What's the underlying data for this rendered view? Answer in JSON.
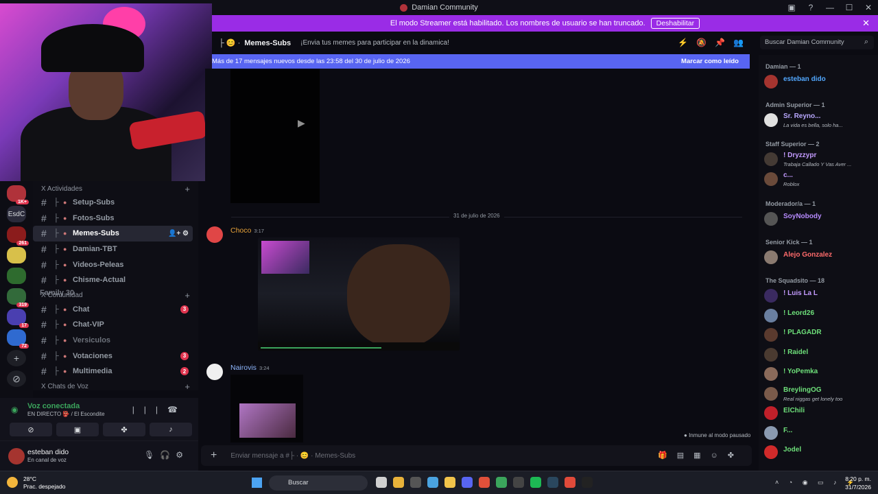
{
  "window": {
    "title": "Damian Community",
    "controls": [
      "▣",
      "?",
      "—",
      "☐",
      "✕"
    ]
  },
  "banner": {
    "text": "El modo Streamer está habilitado. Los nombres de usuario se han truncado.",
    "button": "Deshabilitar",
    "close": "✕"
  },
  "servers": [
    {
      "label": "",
      "badge": "1K+",
      "color": "#b0323a"
    },
    {
      "label": "EsdC",
      "badge": "",
      "color": "#2a2a3a"
    },
    {
      "label": "",
      "badge": "261",
      "color": "#8b1c1c"
    },
    {
      "label": "",
      "badge": "",
      "color": "#d8c04a"
    },
    {
      "label": "",
      "badge": "",
      "color": "#2e6b2e"
    },
    {
      "label": "",
      "badge": "319",
      "color": "#326a3a"
    },
    {
      "label": "",
      "badge": "17",
      "color": "#4a3fb0"
    },
    {
      "label": "",
      "badge": "72",
      "color": "#2f6ad0"
    }
  ],
  "server_actions": {
    "add": "+",
    "explore": "⊘"
  },
  "categories": {
    "activities": "X Actividades",
    "community": "X Comunidad",
    "voice": "X Chats de Voz"
  },
  "drag_ghost": "Family 30",
  "channels_a": [
    {
      "name": "Setup-Subs",
      "active": false,
      "badge": ""
    },
    {
      "name": "Fotos-Subs",
      "active": false,
      "badge": ""
    },
    {
      "name": "Memes-Subs",
      "active": true,
      "badge": ""
    },
    {
      "name": "Damian-TBT",
      "active": false,
      "badge": ""
    },
    {
      "name": "Videos-Peleas",
      "active": false,
      "badge": ""
    },
    {
      "name": "Chisme-Actual",
      "active": false,
      "badge": ""
    }
  ],
  "channels_b": [
    {
      "name": "Chat",
      "badge": "3",
      "muted": false
    },
    {
      "name": "Chat-VIP",
      "badge": "",
      "muted": false
    },
    {
      "name": "Versiculos",
      "badge": "",
      "muted": true
    },
    {
      "name": "Votaciones",
      "badge": "3",
      "muted": false
    },
    {
      "name": "Multimedia",
      "badge": "2",
      "muted": false
    }
  ],
  "voice": {
    "title": "Voz conectada",
    "sub": "EN DIRECTO 👺 / El Escondite"
  },
  "user": {
    "name": "esteban dido",
    "status": "En canal de voz"
  },
  "channel_header": {
    "name": "Memes-Subs",
    "topic": "¡Envia tus memes para participar en la dinamica!"
  },
  "search": {
    "placeholder": "Buscar Damian Community"
  },
  "new_messages": {
    "text": "Más de 17 mensajes nuevos desde las 23:58 del 30 de julio de 2026",
    "action": "Marcar como leído"
  },
  "date_divider": "31 de julio de 2026",
  "messages": [
    {
      "author": "Choco",
      "time": "3:17",
      "color": "#e8a33a"
    },
    {
      "author": "Nairovis",
      "time": "3:24",
      "color": "#8fb8ff"
    }
  ],
  "paused_notice": "Inmune al modo pausado",
  "composer": {
    "placeholder": "Enviar mensaje a #├ · 😊 · Memes-Subs"
  },
  "member_roles": [
    {
      "role": "Damian — 1",
      "members": [
        {
          "name": "esteban dido",
          "status": "",
          "color": "#52a8ff",
          "avatar": "#a5342f"
        }
      ]
    },
    {
      "role": "Admin Superior — 1",
      "members": [
        {
          "name": "Sr. Reyno...",
          "status": "La vida es bella, solo ha...",
          "color": "#b9a8ff",
          "avatar": "#e0e0e0"
        }
      ]
    },
    {
      "role": "Staff Superior — 2",
      "members": [
        {
          "name": "! Dryzzypr",
          "status": "Trabaja Callado Y Vas Aver ...",
          "color": "#c49bff",
          "avatar": "#443a34"
        },
        {
          "name": "c...",
          "status": "Roblox",
          "color": "#c49bff",
          "avatar": "#6a4a3a"
        }
      ]
    },
    {
      "role": "Moderador/a — 1",
      "members": [
        {
          "name": "SoyNobody",
          "status": "",
          "color": "#b78bff",
          "avatar": "#555"
        }
      ]
    },
    {
      "role": "Senior Kick — 1",
      "members": [
        {
          "name": "Alejo Gonzalez",
          "status": "",
          "color": "#ff6b6b",
          "avatar": "#8a7a70"
        }
      ]
    },
    {
      "role": "The Squadsito — 18",
      "members": [
        {
          "name": "! Luis La L",
          "status": "",
          "color": "#c49bff",
          "avatar": "#3a2a60"
        },
        {
          "name": "! Leord26",
          "status": "",
          "color": "#6ee07a",
          "avatar": "#6a7fa0"
        },
        {
          "name": "! PLAGADR",
          "status": "",
          "color": "#6ee07a",
          "avatar": "#5a3a2e"
        },
        {
          "name": "! Raidel",
          "status": "",
          "color": "#6ee07a",
          "avatar": "#4a3a30"
        },
        {
          "name": "! YoPemka",
          "status": "",
          "color": "#6ee07a",
          "avatar": "#8a6a5a"
        },
        {
          "name": "BreylingOG",
          "status": "Real niggas get lonely too",
          "color": "#6ee07a",
          "avatar": "#7a5a4a"
        },
        {
          "name": "ElChili",
          "status": "",
          "color": "#6ee07a",
          "avatar": "#c0202a"
        },
        {
          "name": "F...",
          "status": "",
          "color": "#6ee07a",
          "avatar": "#8a9ab0"
        },
        {
          "name": "Jodel",
          "status": "",
          "color": "#6ee07a",
          "avatar": "#d02a2a"
        }
      ]
    }
  ],
  "taskbar": {
    "temp": "28°C",
    "weather": "Prac. despejado",
    "search": "Buscar",
    "time": "8:20 p. m.",
    "date": "31/7/2026"
  }
}
